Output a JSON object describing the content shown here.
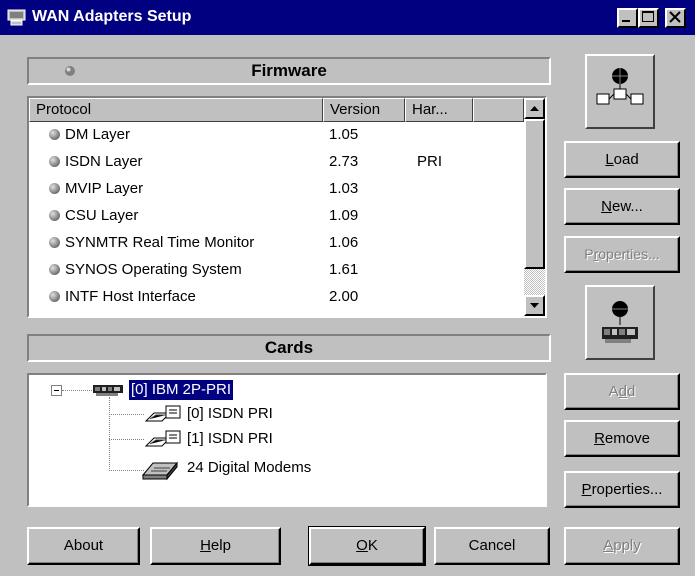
{
  "window": {
    "title": "WAN Adapters Setup"
  },
  "firmware": {
    "section_title": "Firmware",
    "columns": [
      "Protocol",
      "Version",
      "Har..."
    ],
    "rows": [
      {
        "name": "DM Layer",
        "version": "1.05",
        "hardware": ""
      },
      {
        "name": "ISDN Layer",
        "version": "2.73",
        "hardware": "PRI"
      },
      {
        "name": "MVIP Layer",
        "version": "1.03",
        "hardware": ""
      },
      {
        "name": "CSU Layer",
        "version": "1.09",
        "hardware": ""
      },
      {
        "name": "SYNMTR Real Time Monitor",
        "version": "1.06",
        "hardware": ""
      },
      {
        "name": "SYNOS Operating System",
        "version": "1.61",
        "hardware": ""
      },
      {
        "name": "INTF Host Interface",
        "version": "2.00",
        "hardware": ""
      }
    ]
  },
  "cards": {
    "section_title": "Cards",
    "root": {
      "label": "[0] IBM 2P-PRI",
      "toggle": "−"
    },
    "children": [
      {
        "label": "[0] ISDN PRI"
      },
      {
        "label": "[1] ISDN PRI"
      },
      {
        "label": "24 Digital Modems"
      }
    ]
  },
  "side_buttons": {
    "load": {
      "pre": "",
      "key": "L",
      "post": "oad"
    },
    "new": {
      "pre": "",
      "key": "N",
      "post": "ew..."
    },
    "properties_firmware": {
      "pre": "P",
      "key": "r",
      "post": "operties..."
    },
    "add": {
      "pre": "A",
      "key": "d",
      "post": "d"
    },
    "remove": {
      "pre": "",
      "key": "R",
      "post": "emove"
    },
    "properties_cards": {
      "pre": "",
      "key": "P",
      "post": "roperties..."
    }
  },
  "bottom_buttons": {
    "about": "About",
    "help": {
      "pre": "",
      "key": "H",
      "post": "elp"
    },
    "ok": {
      "pre": "",
      "key": "O",
      "post": "K"
    },
    "cancel": "Cancel",
    "apply": {
      "pre": "",
      "key": "A",
      "post": "pply"
    }
  },
  "colors": {
    "title_bar": "#000080",
    "face": "#c0c0c0",
    "selection": "#000080"
  }
}
